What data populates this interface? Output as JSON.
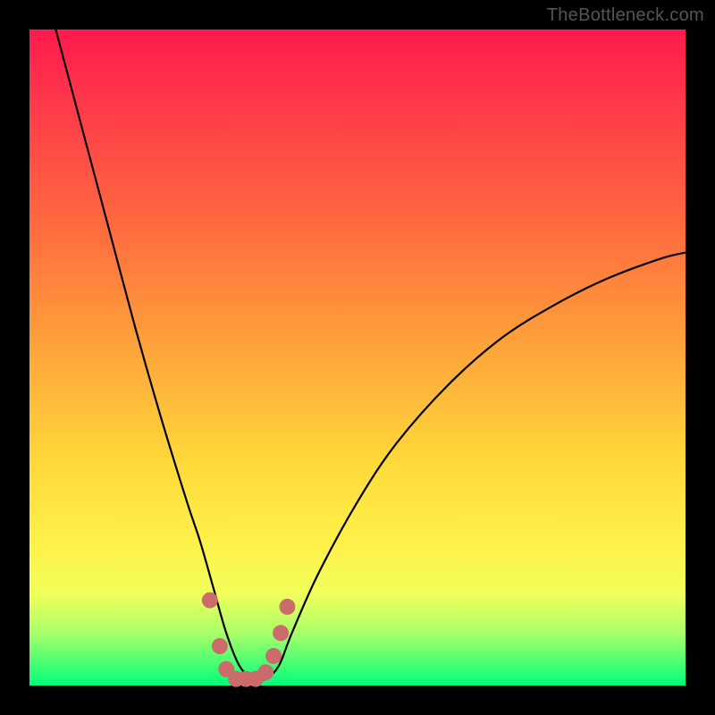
{
  "watermark": "TheBottleneck.com",
  "chart_data": {
    "type": "line",
    "title": "",
    "xlabel": "",
    "ylabel": "",
    "xlim": [
      0,
      100
    ],
    "ylim": [
      0,
      100
    ],
    "series": [
      {
        "name": "bottleneck-curve",
        "x": [
          4,
          8,
          12,
          16,
          20,
          24,
          26,
          28,
          30,
          32,
          34,
          36,
          38,
          40,
          44,
          50,
          56,
          64,
          72,
          80,
          88,
          96,
          100
        ],
        "y": [
          100,
          85,
          70,
          55,
          41,
          28,
          22,
          15,
          8,
          3,
          1,
          1,
          3,
          8,
          17,
          28,
          37,
          46,
          53,
          58,
          62,
          65,
          66
        ]
      }
    ],
    "markers": {
      "name": "highlight-dots",
      "color": "#cc6b6b",
      "x": [
        27.5,
        29,
        30,
        31.5,
        33,
        34.5,
        36,
        37.2,
        38.3,
        39.3
      ],
      "y": [
        13,
        6,
        2.5,
        1,
        1,
        1,
        2,
        4.5,
        8,
        12
      ]
    }
  }
}
